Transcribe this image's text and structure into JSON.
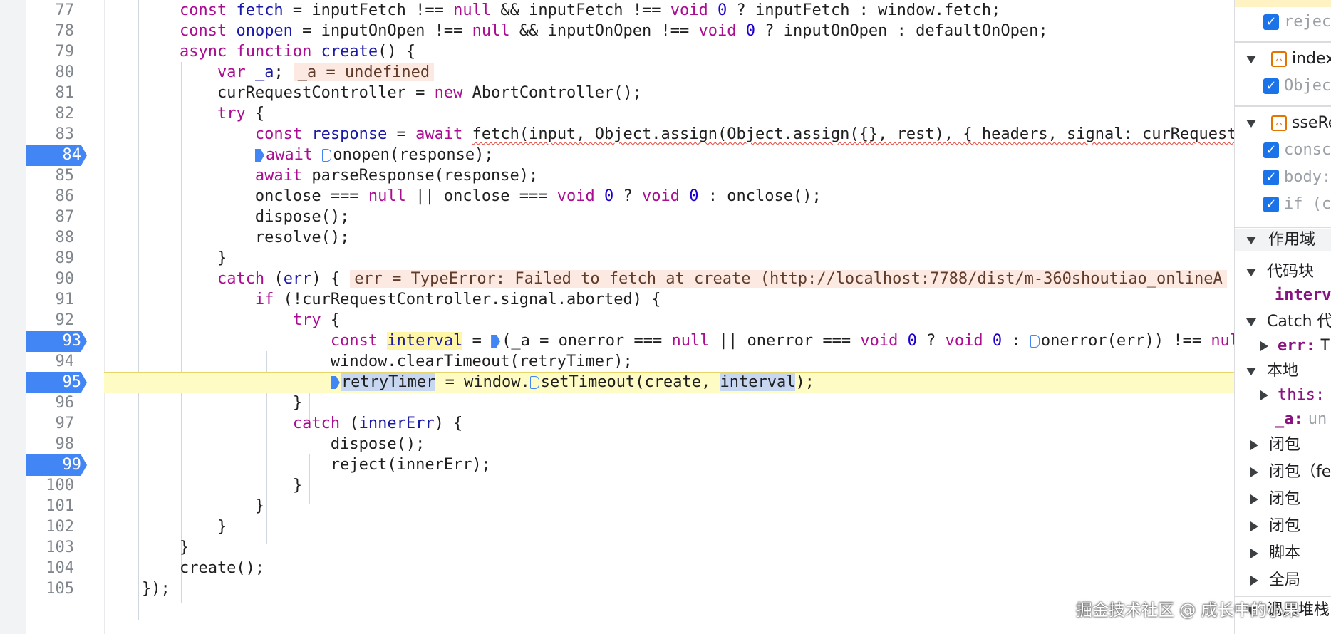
{
  "editor": {
    "line_numbers": [
      "77",
      "78",
      "79",
      "80",
      "81",
      "82",
      "83",
      "84",
      "85",
      "86",
      "87",
      "88",
      "89",
      "90",
      "91",
      "92",
      "93",
      "94",
      "95",
      "96",
      "97",
      "98",
      "99",
      "100",
      "101",
      "102",
      "103",
      "104",
      "105"
    ],
    "breakpoint_lines": [
      "84",
      "93",
      "95",
      "99"
    ],
    "execution_line": "95",
    "inline_values": {
      "a": "_a = undefined",
      "err": "err = TypeError: Failed to fetch at create (http://localhost:7788/dist/m-360shoutiao_onlineA"
    }
  },
  "right_panel": {
    "top_item": "rejec",
    "file1": "index",
    "file1_item": "Objec",
    "file2": "sseRe",
    "file2_items": [
      "consc",
      "body:",
      "if (c"
    ],
    "scope_title": "作用域",
    "block_title": "代码块",
    "block_var": "interv",
    "catch_title": "Catch 代",
    "catch_var": "err:",
    "catch_val": "T",
    "local_title": "本地",
    "local_this": "this:",
    "local_a": "_a:",
    "local_a_val": "un",
    "closures": [
      "闭包",
      "闭包（fe",
      "闭包",
      "闭包"
    ],
    "script": "脚本",
    "global": "全局",
    "callstack": "调用堆栈"
  },
  "watermark": "掘金技术社区 @ 成长中的小果"
}
